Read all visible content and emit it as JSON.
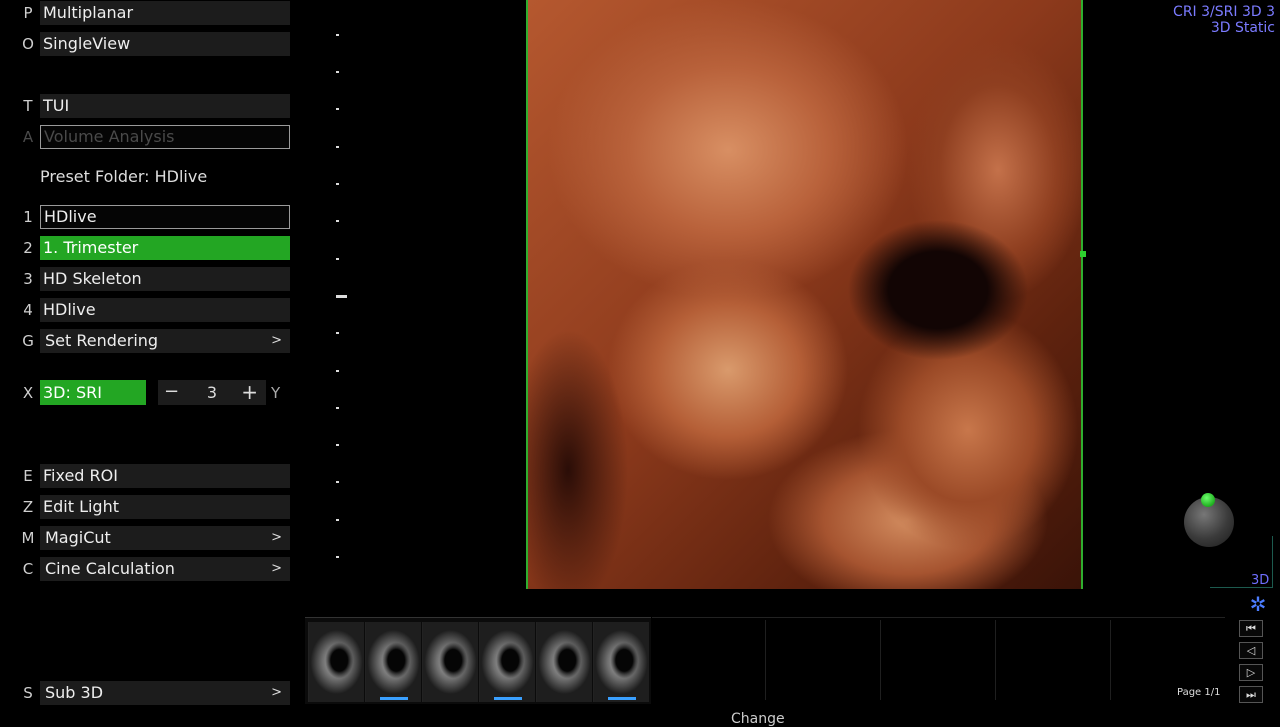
{
  "menu": {
    "multiplanar": {
      "key": "P",
      "label": "Multiplanar"
    },
    "singleview": {
      "key": "O",
      "label": "SingleView"
    },
    "tui": {
      "key": "T",
      "label": "TUI"
    },
    "volume_analysis": {
      "key": "A",
      "label": "Volume Analysis"
    },
    "preset_folder": "Preset Folder: HDlive",
    "presets": [
      {
        "key": "1",
        "label": "HDlive"
      },
      {
        "key": "2",
        "label": "1. Trimester"
      },
      {
        "key": "3",
        "label": "HD Skeleton"
      },
      {
        "key": "4",
        "label": "HDlive"
      }
    ],
    "set_rendering": {
      "key": "G",
      "label": "Set Rendering",
      "arrow": ">"
    },
    "render_mode": {
      "key": "X",
      "label": "3D: SRI",
      "minus": "−",
      "value": "3",
      "plus": "+",
      "right_key": "Y"
    },
    "fixed_roi": {
      "key": "E",
      "label": "Fixed ROI"
    },
    "edit_light": {
      "key": "Z",
      "label": "Edit Light"
    },
    "magicut": {
      "key": "M",
      "label": "MagiCut",
      "arrow": ">"
    },
    "cine_calc": {
      "key": "C",
      "label": "Cine Calculation",
      "arrow": ">"
    },
    "sub3d": {
      "key": "S",
      "label": "Sub 3D",
      "arrow": ">"
    }
  },
  "overlay": {
    "line1": "CRI 3/SRI 3D 3",
    "line2": "3D Static",
    "label_3d": "3D"
  },
  "colors": {
    "active_green": "#23a623",
    "roi_green": "#2fae2f",
    "overlay_blue": "#7b7bff"
  },
  "icons": {
    "gear": "gear-icon",
    "orientation": "orientation-marker"
  },
  "clipboard": {
    "page": "Page 1/1",
    "nav": [
      "⏮",
      "◁",
      "▷",
      "⏭"
    ],
    "change": "Change"
  }
}
